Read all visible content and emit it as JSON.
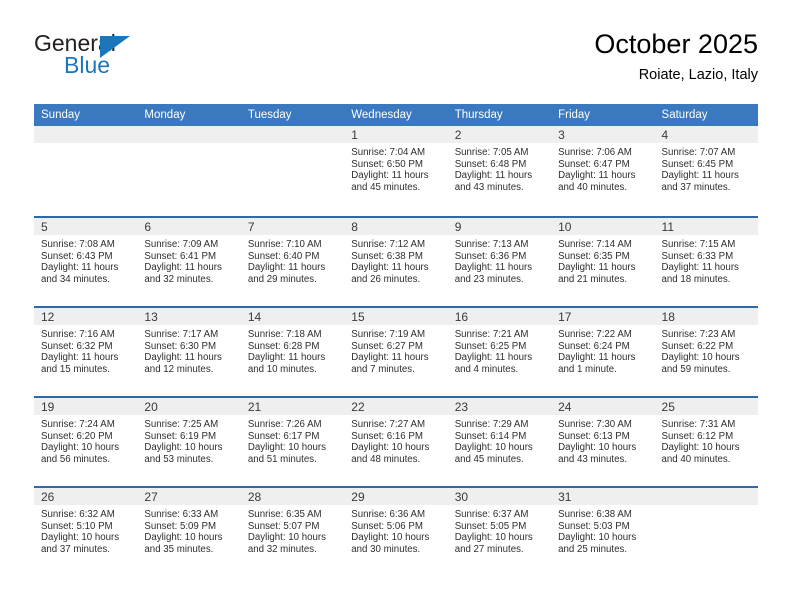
{
  "brand": {
    "name_top": "General",
    "name_bottom": "Blue",
    "triangle_color": "#1b76bc",
    "text_color": "#231f20"
  },
  "header": {
    "title": "October 2025",
    "subtitle": "Roiate, Lazio, Italy"
  },
  "colors": {
    "header_blue": "#3a79bf",
    "row_divider_blue": "#2f6aa8",
    "daynum_band": "#efefef",
    "text": "#000000"
  },
  "weekday_headers": [
    "Sunday",
    "Monday",
    "Tuesday",
    "Wednesday",
    "Thursday",
    "Friday",
    "Saturday"
  ],
  "weeks": [
    [
      {
        "day": "",
        "sunrise": "",
        "sunset": "",
        "daylight_line1": "",
        "daylight_line2": ""
      },
      {
        "day": "",
        "sunrise": "",
        "sunset": "",
        "daylight_line1": "",
        "daylight_line2": ""
      },
      {
        "day": "",
        "sunrise": "",
        "sunset": "",
        "daylight_line1": "",
        "daylight_line2": ""
      },
      {
        "day": "1",
        "sunrise": "Sunrise: 7:04 AM",
        "sunset": "Sunset: 6:50 PM",
        "daylight_line1": "Daylight: 11 hours",
        "daylight_line2": "and 45 minutes."
      },
      {
        "day": "2",
        "sunrise": "Sunrise: 7:05 AM",
        "sunset": "Sunset: 6:48 PM",
        "daylight_line1": "Daylight: 11 hours",
        "daylight_line2": "and 43 minutes."
      },
      {
        "day": "3",
        "sunrise": "Sunrise: 7:06 AM",
        "sunset": "Sunset: 6:47 PM",
        "daylight_line1": "Daylight: 11 hours",
        "daylight_line2": "and 40 minutes."
      },
      {
        "day": "4",
        "sunrise": "Sunrise: 7:07 AM",
        "sunset": "Sunset: 6:45 PM",
        "daylight_line1": "Daylight: 11 hours",
        "daylight_line2": "and 37 minutes."
      }
    ],
    [
      {
        "day": "5",
        "sunrise": "Sunrise: 7:08 AM",
        "sunset": "Sunset: 6:43 PM",
        "daylight_line1": "Daylight: 11 hours",
        "daylight_line2": "and 34 minutes."
      },
      {
        "day": "6",
        "sunrise": "Sunrise: 7:09 AM",
        "sunset": "Sunset: 6:41 PM",
        "daylight_line1": "Daylight: 11 hours",
        "daylight_line2": "and 32 minutes."
      },
      {
        "day": "7",
        "sunrise": "Sunrise: 7:10 AM",
        "sunset": "Sunset: 6:40 PM",
        "daylight_line1": "Daylight: 11 hours",
        "daylight_line2": "and 29 minutes."
      },
      {
        "day": "8",
        "sunrise": "Sunrise: 7:12 AM",
        "sunset": "Sunset: 6:38 PM",
        "daylight_line1": "Daylight: 11 hours",
        "daylight_line2": "and 26 minutes."
      },
      {
        "day": "9",
        "sunrise": "Sunrise: 7:13 AM",
        "sunset": "Sunset: 6:36 PM",
        "daylight_line1": "Daylight: 11 hours",
        "daylight_line2": "and 23 minutes."
      },
      {
        "day": "10",
        "sunrise": "Sunrise: 7:14 AM",
        "sunset": "Sunset: 6:35 PM",
        "daylight_line1": "Daylight: 11 hours",
        "daylight_line2": "and 21 minutes."
      },
      {
        "day": "11",
        "sunrise": "Sunrise: 7:15 AM",
        "sunset": "Sunset: 6:33 PM",
        "daylight_line1": "Daylight: 11 hours",
        "daylight_line2": "and 18 minutes."
      }
    ],
    [
      {
        "day": "12",
        "sunrise": "Sunrise: 7:16 AM",
        "sunset": "Sunset: 6:32 PM",
        "daylight_line1": "Daylight: 11 hours",
        "daylight_line2": "and 15 minutes."
      },
      {
        "day": "13",
        "sunrise": "Sunrise: 7:17 AM",
        "sunset": "Sunset: 6:30 PM",
        "daylight_line1": "Daylight: 11 hours",
        "daylight_line2": "and 12 minutes."
      },
      {
        "day": "14",
        "sunrise": "Sunrise: 7:18 AM",
        "sunset": "Sunset: 6:28 PM",
        "daylight_line1": "Daylight: 11 hours",
        "daylight_line2": "and 10 minutes."
      },
      {
        "day": "15",
        "sunrise": "Sunrise: 7:19 AM",
        "sunset": "Sunset: 6:27 PM",
        "daylight_line1": "Daylight: 11 hours",
        "daylight_line2": "and 7 minutes."
      },
      {
        "day": "16",
        "sunrise": "Sunrise: 7:21 AM",
        "sunset": "Sunset: 6:25 PM",
        "daylight_line1": "Daylight: 11 hours",
        "daylight_line2": "and 4 minutes."
      },
      {
        "day": "17",
        "sunrise": "Sunrise: 7:22 AM",
        "sunset": "Sunset: 6:24 PM",
        "daylight_line1": "Daylight: 11 hours",
        "daylight_line2": "and 1 minute."
      },
      {
        "day": "18",
        "sunrise": "Sunrise: 7:23 AM",
        "sunset": "Sunset: 6:22 PM",
        "daylight_line1": "Daylight: 10 hours",
        "daylight_line2": "and 59 minutes."
      }
    ],
    [
      {
        "day": "19",
        "sunrise": "Sunrise: 7:24 AM",
        "sunset": "Sunset: 6:20 PM",
        "daylight_line1": "Daylight: 10 hours",
        "daylight_line2": "and 56 minutes."
      },
      {
        "day": "20",
        "sunrise": "Sunrise: 7:25 AM",
        "sunset": "Sunset: 6:19 PM",
        "daylight_line1": "Daylight: 10 hours",
        "daylight_line2": "and 53 minutes."
      },
      {
        "day": "21",
        "sunrise": "Sunrise: 7:26 AM",
        "sunset": "Sunset: 6:17 PM",
        "daylight_line1": "Daylight: 10 hours",
        "daylight_line2": "and 51 minutes."
      },
      {
        "day": "22",
        "sunrise": "Sunrise: 7:27 AM",
        "sunset": "Sunset: 6:16 PM",
        "daylight_line1": "Daylight: 10 hours",
        "daylight_line2": "and 48 minutes."
      },
      {
        "day": "23",
        "sunrise": "Sunrise: 7:29 AM",
        "sunset": "Sunset: 6:14 PM",
        "daylight_line1": "Daylight: 10 hours",
        "daylight_line2": "and 45 minutes."
      },
      {
        "day": "24",
        "sunrise": "Sunrise: 7:30 AM",
        "sunset": "Sunset: 6:13 PM",
        "daylight_line1": "Daylight: 10 hours",
        "daylight_line2": "and 43 minutes."
      },
      {
        "day": "25",
        "sunrise": "Sunrise: 7:31 AM",
        "sunset": "Sunset: 6:12 PM",
        "daylight_line1": "Daylight: 10 hours",
        "daylight_line2": "and 40 minutes."
      }
    ],
    [
      {
        "day": "26",
        "sunrise": "Sunrise: 6:32 AM",
        "sunset": "Sunset: 5:10 PM",
        "daylight_line1": "Daylight: 10 hours",
        "daylight_line2": "and 37 minutes."
      },
      {
        "day": "27",
        "sunrise": "Sunrise: 6:33 AM",
        "sunset": "Sunset: 5:09 PM",
        "daylight_line1": "Daylight: 10 hours",
        "daylight_line2": "and 35 minutes."
      },
      {
        "day": "28",
        "sunrise": "Sunrise: 6:35 AM",
        "sunset": "Sunset: 5:07 PM",
        "daylight_line1": "Daylight: 10 hours",
        "daylight_line2": "and 32 minutes."
      },
      {
        "day": "29",
        "sunrise": "Sunrise: 6:36 AM",
        "sunset": "Sunset: 5:06 PM",
        "daylight_line1": "Daylight: 10 hours",
        "daylight_line2": "and 30 minutes."
      },
      {
        "day": "30",
        "sunrise": "Sunrise: 6:37 AM",
        "sunset": "Sunset: 5:05 PM",
        "daylight_line1": "Daylight: 10 hours",
        "daylight_line2": "and 27 minutes."
      },
      {
        "day": "31",
        "sunrise": "Sunrise: 6:38 AM",
        "sunset": "Sunset: 5:03 PM",
        "daylight_line1": "Daylight: 10 hours",
        "daylight_line2": "and 25 minutes."
      },
      {
        "day": "",
        "sunrise": "",
        "sunset": "",
        "daylight_line1": "",
        "daylight_line2": ""
      }
    ]
  ]
}
